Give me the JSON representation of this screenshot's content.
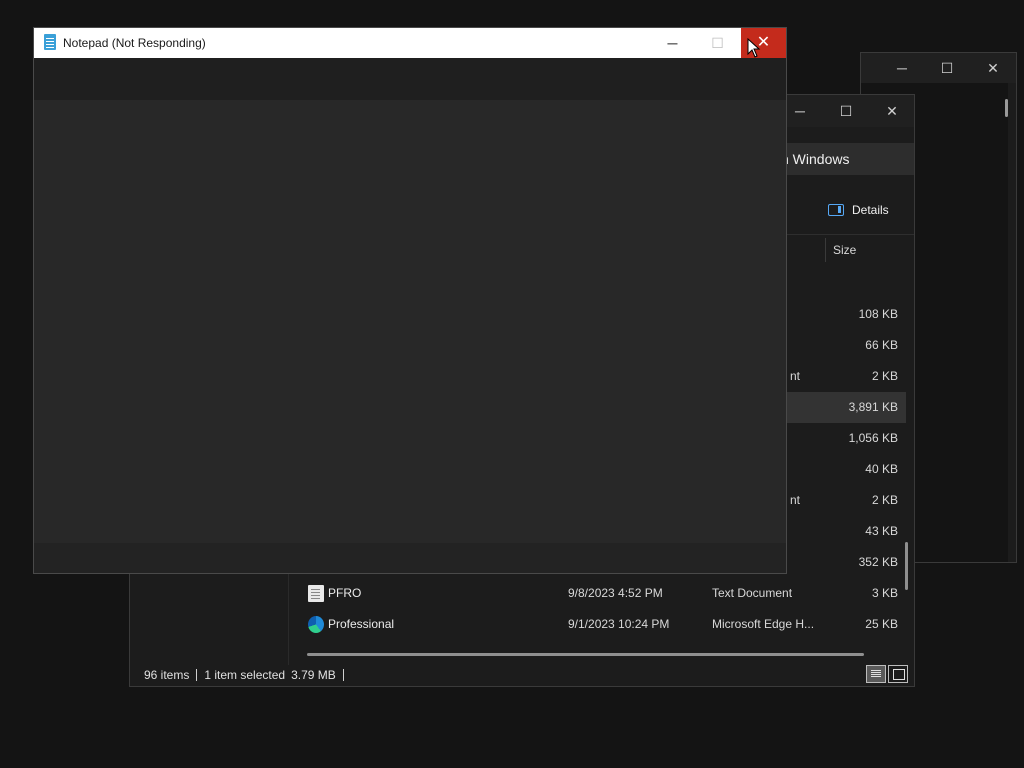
{
  "back_window": {
    "minimize_glyph": "─",
    "maximize_glyph": "☐",
    "close_glyph": "✕"
  },
  "explorer": {
    "minimize_glyph": "─",
    "maximize_glyph": "☐",
    "close_glyph": "✕",
    "search_text": "ch Windows",
    "details_label": "Details",
    "size_column": "Size",
    "rows": [
      {
        "size": "108 KB",
        "type_fragment": ""
      },
      {
        "size": "66 KB",
        "type_fragment": ""
      },
      {
        "size": "2 KB",
        "type_fragment": "nt"
      },
      {
        "size": "3,891 KB",
        "type_fragment": "",
        "selected": true
      },
      {
        "size": "1,056 KB",
        "type_fragment": ""
      },
      {
        "size": "40 KB",
        "type_fragment": ""
      },
      {
        "size": "2 KB",
        "type_fragment": "nt"
      },
      {
        "size": "43 KB",
        "type_fragment": ""
      },
      {
        "size": "352 KB",
        "type_fragment": ""
      },
      {
        "name": "PFRO",
        "date": "9/8/2023 4:52 PM",
        "type": "Text Document",
        "size": "3 KB",
        "icon": "text-file-icon"
      },
      {
        "name": "Professional",
        "date": "9/1/2023 10:24 PM",
        "type": "Microsoft Edge H...",
        "size": "25 KB",
        "icon": "edge-icon"
      }
    ],
    "status": {
      "item_count": "96 items",
      "selection": "1 item selected",
      "selection_size": "3.79 MB"
    }
  },
  "notepad": {
    "title": "Notepad (Not Responding)",
    "minimize_glyph": "─",
    "maximize_glyph": "☐",
    "close_glyph": "✕"
  }
}
